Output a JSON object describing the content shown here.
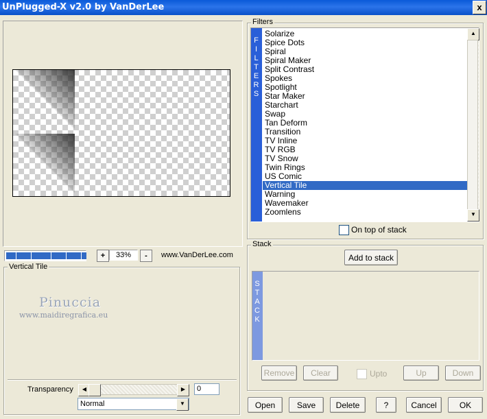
{
  "window": {
    "title": "UnPlugged-X v2.0 by VanDerLee",
    "close_label": "x"
  },
  "preview": {
    "zoom_out_label": "-",
    "zoom_in_label": "+",
    "zoom_value": "33%",
    "website": "www.VanDerLee.com",
    "progress_blocks": 16
  },
  "settings": {
    "title": "Vertical Tile",
    "watermark_title": "Pinuccia",
    "watermark_url": "www.maidiregrafica.eu",
    "transparency_label": "Transparency",
    "transparency_value": "0",
    "transparency_fraction": 0.0,
    "blend_mode": "Normal"
  },
  "filters": {
    "label": "Filters",
    "strip_letters": [
      "F",
      "I",
      "L",
      "T",
      "E",
      "R",
      "S"
    ],
    "items": [
      "Solarize",
      "Spice Dots",
      "Spiral",
      "Spiral Maker",
      "Split Contrast",
      "Spokes",
      "Spotlight",
      "Star Maker",
      "Starchart",
      "Swap",
      "Tan Deform",
      "Transition",
      "TV Inline",
      "TV RGB",
      "TV Snow",
      "Twin Rings",
      "US Comic",
      "Vertical Tile",
      "Warning",
      "Wavemaker",
      "Zoomlens"
    ],
    "selected": "Vertical Tile",
    "on_top_label": "On top of stack"
  },
  "stack": {
    "label": "Stack",
    "add_label": "Add to stack",
    "strip_letters": [
      "S",
      "T",
      "A",
      "C",
      "K"
    ],
    "remove_label": "Remove",
    "clear_label": "Clear",
    "upto_label": "Upto",
    "up_label": "Up",
    "down_label": "Down"
  },
  "footer": {
    "open": "Open",
    "save": "Save",
    "delete": "Delete",
    "help": "?",
    "cancel": "Cancel",
    "ok": "OK"
  },
  "colors": {
    "title_bar": "#0a5ad8",
    "strip": "#2a5fd8",
    "selection": "#316ac5",
    "window_bg": "#ece9d8"
  }
}
